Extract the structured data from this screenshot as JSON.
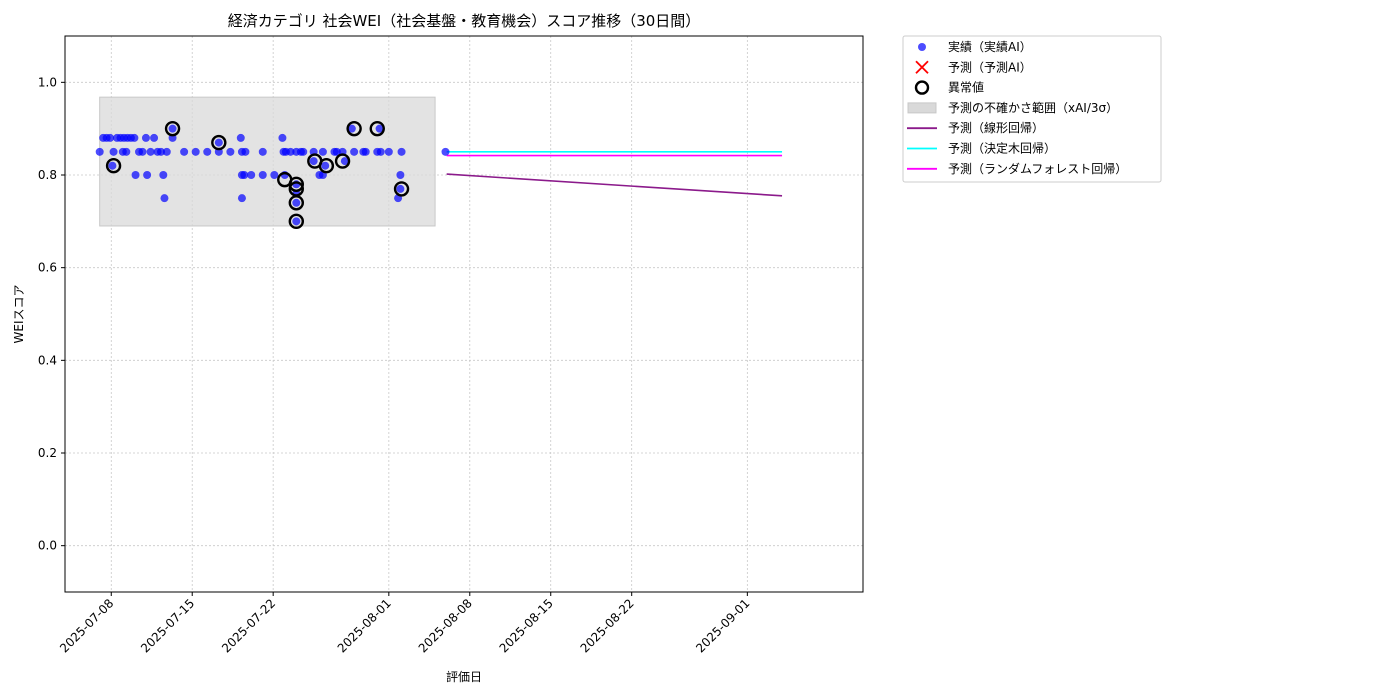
{
  "chart_data": {
    "type": "scatter",
    "title": "経済カテゴリ 社会WEI（社会基盤・教育機会）スコア推移（30日間）",
    "xlabel": "評価日",
    "ylabel": "WEIスコア",
    "xlim": [
      "2025-07-04",
      "2025-09-11"
    ],
    "ylim": [
      -0.1,
      1.1
    ],
    "yticks": [
      0.0,
      0.2,
      0.4,
      0.6,
      0.8,
      1.0
    ],
    "ytick_labels": [
      "0.0",
      "0.2",
      "0.4",
      "0.6",
      "0.8",
      "1.0"
    ],
    "xticks": [
      "2025-07-08",
      "2025-07-15",
      "2025-07-22",
      "2025-08-01",
      "2025-08-08",
      "2025-08-15",
      "2025-08-22",
      "2025-09-01"
    ],
    "xtick_labels": [
      "2025-07-08",
      "2025-07-15",
      "2025-07-22",
      "2025-08-01",
      "2025-08-08",
      "2025-08-15",
      "2025-08-22",
      "2025-09-01"
    ],
    "grid": true,
    "legend_position": "outside-top-right",
    "legend": [
      {
        "label": "実績（実績AI）",
        "kind": "dot",
        "color": "#0000ff"
      },
      {
        "label": "予測（予測AI）",
        "kind": "x",
        "color": "#ff0000"
      },
      {
        "label": "異常値",
        "kind": "ring",
        "color": "#000000"
      },
      {
        "label": "予測の不確かさ範囲（xAI/3σ）",
        "kind": "band",
        "color": "#d9d9d9"
      },
      {
        "label": "予測（線形回帰）",
        "kind": "line",
        "color": "#8b1a8b"
      },
      {
        "label": "予測（決定木回帰）",
        "kind": "line",
        "color": "#00ffff"
      },
      {
        "label": "予測（ランダムフォレスト回帰）",
        "kind": "line",
        "color": "#ff00ff"
      }
    ],
    "uncertainty_band": {
      "x": [
        "2025-07-07",
        "2025-08-05"
      ],
      "y": [
        0.69,
        0.968
      ],
      "color": "#d9d9d9"
    },
    "actual": {
      "name": "実績（実績AI）",
      "color": "#0000ff",
      "points": [
        [
          "2025-07-07",
          0.85
        ],
        [
          "2025-07-07.3",
          0.88
        ],
        [
          "2025-07-07.6",
          0.88
        ],
        [
          "2025-07-07.9",
          0.88
        ],
        [
          "2025-07-08.1",
          0.82
        ],
        [
          "2025-07-08.2",
          0.85
        ],
        [
          "2025-07-08.5",
          0.88
        ],
        [
          "2025-07-08.8",
          0.88
        ],
        [
          "2025-07-09",
          0.85
        ],
        [
          "2025-07-09.1",
          0.88
        ],
        [
          "2025-07-09.3",
          0.85
        ],
        [
          "2025-07-09.4",
          0.88
        ],
        [
          "2025-07-09.7",
          0.88
        ],
        [
          "2025-07-10",
          0.88
        ],
        [
          "2025-07-10.1",
          0.8
        ],
        [
          "2025-07-10.4",
          0.85
        ],
        [
          "2025-07-10.7",
          0.85
        ],
        [
          "2025-07-11",
          0.88
        ],
        [
          "2025-07-11.1",
          0.8
        ],
        [
          "2025-07-11.4",
          0.85
        ],
        [
          "2025-07-11.7",
          0.88
        ],
        [
          "2025-07-12",
          0.85
        ],
        [
          "2025-07-12.3",
          0.85
        ],
        [
          "2025-07-12.5",
          0.8
        ],
        [
          "2025-07-12.6",
          0.75
        ],
        [
          "2025-07-12.8",
          0.85
        ],
        [
          "2025-07-13.3",
          0.88
        ],
        [
          "2025-07-13.3",
          0.9
        ],
        [
          "2025-07-14.3",
          0.85
        ],
        [
          "2025-07-15.3",
          0.85
        ],
        [
          "2025-07-16.3",
          0.85
        ],
        [
          "2025-07-17.3",
          0.85
        ],
        [
          "2025-07-17.3",
          0.87
        ],
        [
          "2025-07-18.3",
          0.85
        ],
        [
          "2025-07-19.2",
          0.88
        ],
        [
          "2025-07-19.3",
          0.85
        ],
        [
          "2025-07-19.3",
          0.8
        ],
        [
          "2025-07-19.3",
          0.75
        ],
        [
          "2025-07-19.5",
          0.8
        ],
        [
          "2025-07-19.6",
          0.85
        ],
        [
          "2025-07-20.1",
          0.8
        ],
        [
          "2025-07-21.1",
          0.85
        ],
        [
          "2025-07-21.1",
          0.8
        ],
        [
          "2025-07-22.1",
          0.8
        ],
        [
          "2025-07-22.8",
          0.88
        ],
        [
          "2025-07-22.9",
          0.85
        ],
        [
          "2025-07-23",
          0.8
        ],
        [
          "2025-07-23.1",
          0.85
        ],
        [
          "2025-07-23.5",
          0.85
        ],
        [
          "2025-07-24",
          0.85
        ],
        [
          "2025-07-24",
          0.7
        ],
        [
          "2025-07-24",
          0.74
        ],
        [
          "2025-07-24",
          0.76
        ],
        [
          "2025-07-24",
          0.78
        ],
        [
          "2025-07-24.4",
          0.85
        ],
        [
          "2025-07-24.6",
          0.85
        ],
        [
          "2025-07-25.5",
          0.85
        ],
        [
          "2025-07-25.5",
          0.83
        ],
        [
          "2025-07-26",
          0.8
        ],
        [
          "2025-07-26.3",
          0.85
        ],
        [
          "2025-07-26.3",
          0.8
        ],
        [
          "2025-07-26.5",
          0.82
        ],
        [
          "2025-07-27.3",
          0.85
        ],
        [
          "2025-07-27.5",
          0.85
        ],
        [
          "2025-07-28",
          0.85
        ],
        [
          "2025-07-28.2",
          0.83
        ],
        [
          "2025-07-28.8",
          0.9
        ],
        [
          "2025-07-29",
          0.85
        ],
        [
          "2025-07-29.8",
          0.85
        ],
        [
          "2025-07-30",
          0.85
        ],
        [
          "2025-07-31",
          0.85
        ],
        [
          "2025-07-31.2",
          0.9
        ],
        [
          "2025-07-31.3",
          0.85
        ],
        [
          "2025-08-01",
          0.85
        ],
        [
          "2025-08-01.8",
          0.75
        ],
        [
          "2025-08-02",
          0.8
        ],
        [
          "2025-08-02",
          0.77
        ],
        [
          "2025-08-02.1",
          0.85
        ],
        [
          "2025-08-05.9",
          0.85
        ]
      ]
    },
    "anomalies": {
      "name": "異常値",
      "points": [
        [
          "2025-07-08.2",
          0.82
        ],
        [
          "2025-07-13.3",
          0.9
        ],
        [
          "2025-07-17.3",
          0.87
        ],
        [
          "2025-07-23",
          0.79
        ],
        [
          "2025-07-24",
          0.78
        ],
        [
          "2025-07-24",
          0.77
        ],
        [
          "2025-07-24",
          0.74
        ],
        [
          "2025-07-24",
          0.7
        ],
        [
          "2025-07-25.6",
          0.83
        ],
        [
          "2025-07-26.6",
          0.82
        ],
        [
          "2025-07-28",
          0.83
        ],
        [
          "2025-07-29",
          0.9
        ],
        [
          "2025-07-31",
          0.9
        ],
        [
          "2025-08-02.1",
          0.77
        ]
      ]
    },
    "forecast_lines": [
      {
        "name": "予測（線形回帰）",
        "color": "#8b1a8b",
        "x": [
          "2025-08-06",
          "2025-09-04"
        ],
        "y": [
          0.802,
          0.755
        ]
      },
      {
        "name": "予測（決定木回帰）",
        "color": "#00ffff",
        "x": [
          "2025-08-06",
          "2025-09-04"
        ],
        "y": [
          0.85,
          0.85
        ]
      },
      {
        "name": "予測（ランダムフォレスト回帰）",
        "color": "#ff00ff",
        "x": [
          "2025-08-06",
          "2025-09-04"
        ],
        "y": [
          0.842,
          0.842
        ]
      }
    ]
  }
}
